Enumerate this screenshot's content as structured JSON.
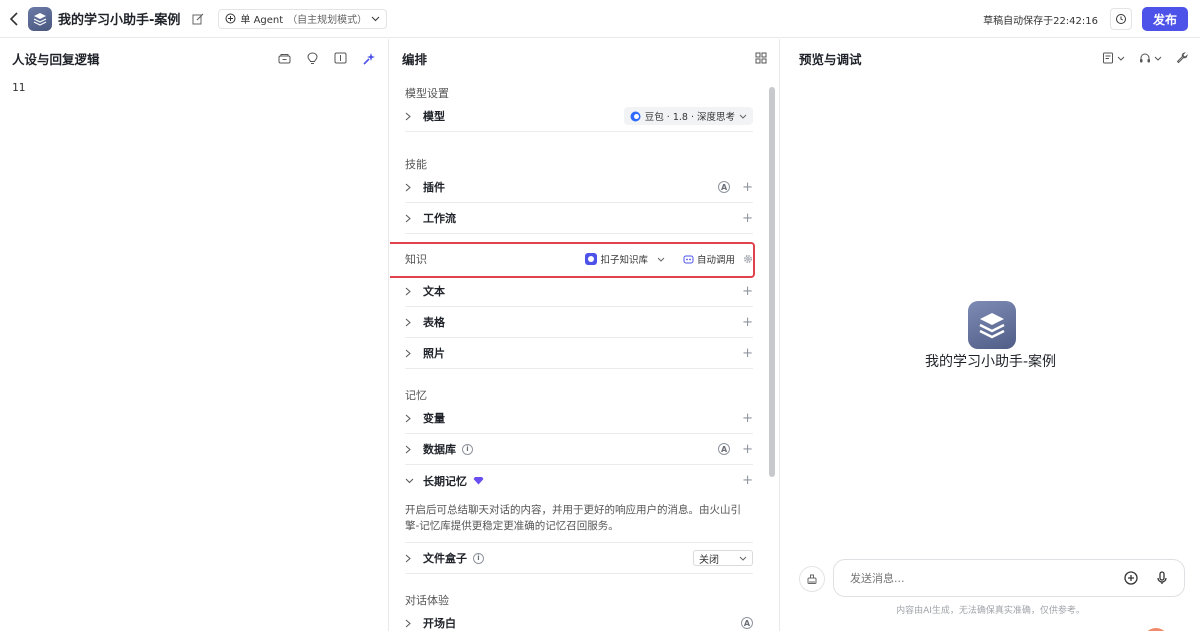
{
  "header": {
    "title": "我的学习小助手-案例",
    "mode_label": "单 Agent",
    "mode_sub": "（自主规划模式）",
    "saved_text": "草稿自动保存于22:42:16",
    "publish_label": "发布"
  },
  "persona": {
    "title": "人设与回复逻辑",
    "content": "11"
  },
  "editor": {
    "title": "编排",
    "model_section": "模型设置",
    "model_label": "模型",
    "model_value": "豆包 · 1.8 · 深度思考",
    "skills_section": "技能",
    "plugin_label": "插件",
    "workflow_label": "工作流",
    "knowledge_section": "知识",
    "knowledge_source": "扣子知识库",
    "knowledge_call": "自动调用",
    "text_label": "文本",
    "table_label": "表格",
    "photo_label": "照片",
    "memory_section": "记忆",
    "variable_label": "变量",
    "database_label": "数据库",
    "longterm_label": "长期记忆",
    "longterm_desc": "开启后可总结聊天对话的内容，并用于更好的响应用户的消息。由火山引擎-记忆库提供更稳定更准确的记忆召回服务。",
    "filebox_label": "文件盒子",
    "filebox_value": "关闭",
    "dialog_section": "对话体验",
    "opening_label": "开场白"
  },
  "preview": {
    "title": "预览与调试",
    "bot_name": "我的学习小助手-案例",
    "input_placeholder": "发送消息...",
    "disclaimer": "内容由AI生成，无法确保真实准确，仅供参考。"
  },
  "colors": {
    "accent": "#4d53e8",
    "highlight": "#e0434e"
  }
}
